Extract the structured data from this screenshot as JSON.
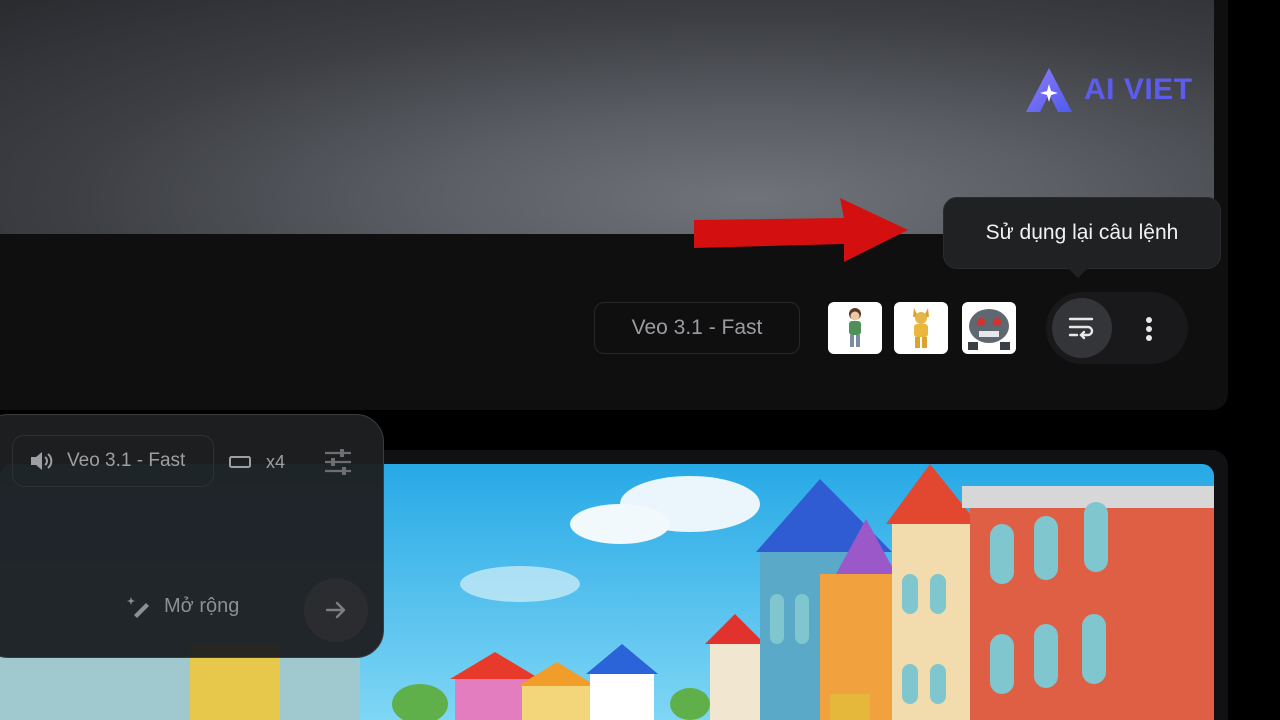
{
  "watermark": {
    "text": "AI VIET",
    "icon": "sparkle-a-logo-icon",
    "color": "#5d5cf0"
  },
  "video_card": {
    "model_label": "Veo 3.1 - Fast",
    "ingredients": [
      {
        "name": "girl-character-thumbnail"
      },
      {
        "name": "cat-character-thumbnail"
      },
      {
        "name": "robot-character-thumbnail"
      }
    ],
    "reuse_prompt_icon": "wrap-text-icon",
    "more_icon": "more-vertical-icon"
  },
  "tooltip": {
    "text": "Sử dụng lại câu lệnh"
  },
  "annotation_arrow": {
    "color": "#d40f0f"
  },
  "prompt_panel": {
    "model_label": "Veo 3.1 - Fast",
    "audio_icon": "speaker-icon",
    "aspect_icon": "landscape-ratio-icon",
    "count_label": "x4",
    "settings_icon": "sliders-icon",
    "expand_label": "Mở rộng",
    "expand_icon": "magic-pen-icon",
    "send_icon": "arrow-right-icon"
  }
}
